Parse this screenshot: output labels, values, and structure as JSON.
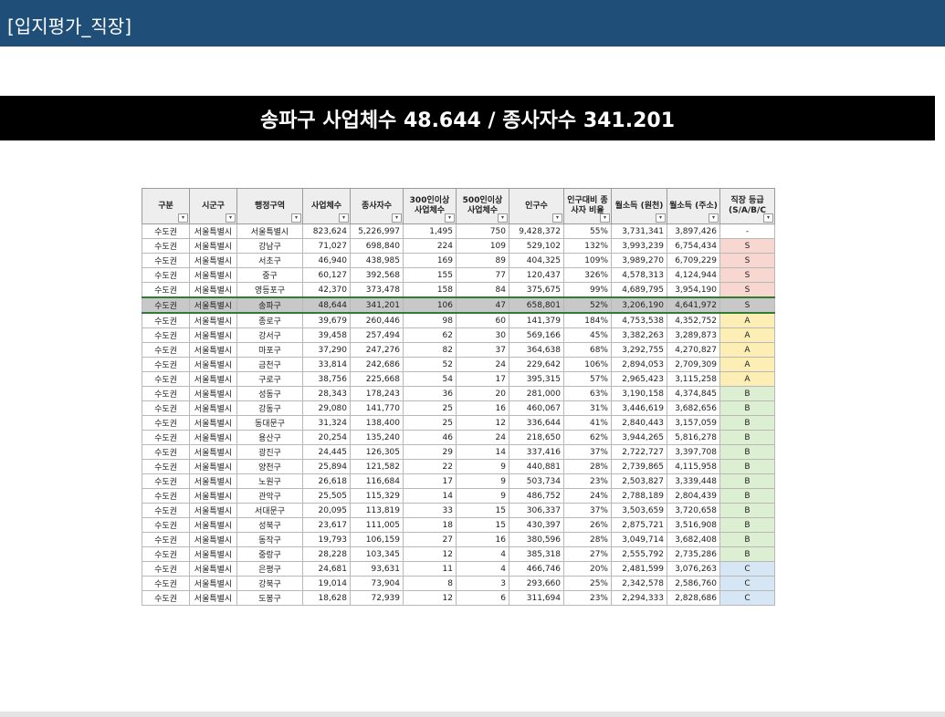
{
  "header": {
    "title": "[입지평가_직장]"
  },
  "banner": {
    "text": "송파구 사업체수 48.644 / 종사자수 341.201"
  },
  "table": {
    "columns": [
      "구분",
      "시군구",
      "행정구역",
      "사업체수",
      "종사자수",
      "300인이상 사업체수",
      "500인이상 사업체수",
      "인구수",
      "인구대비 종사자 비율",
      "월소득 (원천)",
      "월소득 (주소)",
      "직장 등급 (S/A/B/C"
    ],
    "highlight_row": 5,
    "rows": [
      [
        "수도권",
        "서울특별시",
        "서울특별시",
        "823,624",
        "5,226,997",
        "1,495",
        "750",
        "9,428,372",
        "55%",
        "3,731,341",
        "3,897,426",
        "-"
      ],
      [
        "수도권",
        "서울특별시",
        "강남구",
        "71,027",
        "698,840",
        "224",
        "109",
        "529,102",
        "132%",
        "3,993,239",
        "6,754,434",
        "S"
      ],
      [
        "수도권",
        "서울특별시",
        "서초구",
        "46,940",
        "438,985",
        "169",
        "89",
        "404,325",
        "109%",
        "3,989,270",
        "6,709,229",
        "S"
      ],
      [
        "수도권",
        "서울특별시",
        "중구",
        "60,127",
        "392,568",
        "155",
        "77",
        "120,437",
        "326%",
        "4,578,313",
        "4,124,944",
        "S"
      ],
      [
        "수도권",
        "서울특별시",
        "영등포구",
        "42,370",
        "373,478",
        "158",
        "84",
        "375,675",
        "99%",
        "4,689,795",
        "3,954,190",
        "S"
      ],
      [
        "수도권",
        "서울특별시",
        "송파구",
        "48,644",
        "341,201",
        "106",
        "47",
        "658,801",
        "52%",
        "3,206,190",
        "4,641,972",
        "S"
      ],
      [
        "수도권",
        "서울특별시",
        "종로구",
        "39,679",
        "260,446",
        "98",
        "60",
        "141,379",
        "184%",
        "4,753,538",
        "4,352,752",
        "A"
      ],
      [
        "수도권",
        "서울특별시",
        "강서구",
        "39,458",
        "257,494",
        "62",
        "30",
        "569,166",
        "45%",
        "3,382,263",
        "3,289,873",
        "A"
      ],
      [
        "수도권",
        "서울특별시",
        "마포구",
        "37,290",
        "247,276",
        "82",
        "37",
        "364,638",
        "68%",
        "3,292,755",
        "4,270,827",
        "A"
      ],
      [
        "수도권",
        "서울특별시",
        "금천구",
        "33,814",
        "242,686",
        "52",
        "24",
        "229,642",
        "106%",
        "2,894,053",
        "2,709,309",
        "A"
      ],
      [
        "수도권",
        "서울특별시",
        "구로구",
        "38,756",
        "225,668",
        "54",
        "17",
        "395,315",
        "57%",
        "2,965,423",
        "3,115,258",
        "A"
      ],
      [
        "수도권",
        "서울특별시",
        "성동구",
        "28,343",
        "178,243",
        "36",
        "20",
        "281,000",
        "63%",
        "3,190,158",
        "4,374,845",
        "B"
      ],
      [
        "수도권",
        "서울특별시",
        "강동구",
        "29,080",
        "141,770",
        "25",
        "16",
        "460,067",
        "31%",
        "3,446,619",
        "3,682,656",
        "B"
      ],
      [
        "수도권",
        "서울특별시",
        "동대문구",
        "31,324",
        "138,400",
        "25",
        "12",
        "336,644",
        "41%",
        "2,840,443",
        "3,157,059",
        "B"
      ],
      [
        "수도권",
        "서울특별시",
        "용산구",
        "20,254",
        "135,240",
        "46",
        "24",
        "218,650",
        "62%",
        "3,944,265",
        "5,816,278",
        "B"
      ],
      [
        "수도권",
        "서울특별시",
        "광진구",
        "24,445",
        "126,305",
        "29",
        "14",
        "337,416",
        "37%",
        "2,722,727",
        "3,397,708",
        "B"
      ],
      [
        "수도권",
        "서울특별시",
        "양천구",
        "25,894",
        "121,582",
        "22",
        "9",
        "440,881",
        "28%",
        "2,739,865",
        "4,115,958",
        "B"
      ],
      [
        "수도권",
        "서울특별시",
        "노원구",
        "26,618",
        "116,684",
        "17",
        "9",
        "503,734",
        "23%",
        "2,503,827",
        "3,339,448",
        "B"
      ],
      [
        "수도권",
        "서울특별시",
        "관악구",
        "25,505",
        "115,329",
        "14",
        "9",
        "486,752",
        "24%",
        "2,788,189",
        "2,804,439",
        "B"
      ],
      [
        "수도권",
        "서울특별시",
        "서대문구",
        "20,095",
        "113,819",
        "33",
        "15",
        "306,337",
        "37%",
        "3,503,659",
        "3,720,658",
        "B"
      ],
      [
        "수도권",
        "서울특별시",
        "성북구",
        "23,617",
        "111,005",
        "18",
        "15",
        "430,397",
        "26%",
        "2,875,721",
        "3,516,908",
        "B"
      ],
      [
        "수도권",
        "서울특별시",
        "동작구",
        "19,793",
        "106,159",
        "27",
        "16",
        "380,596",
        "28%",
        "3,049,714",
        "3,682,408",
        "B"
      ],
      [
        "수도권",
        "서울특별시",
        "중랑구",
        "28,228",
        "103,345",
        "12",
        "4",
        "385,318",
        "27%",
        "2,555,792",
        "2,735,286",
        "B"
      ],
      [
        "수도권",
        "서울특별시",
        "은평구",
        "24,681",
        "93,631",
        "11",
        "4",
        "466,746",
        "20%",
        "2,481,599",
        "3,076,263",
        "C"
      ],
      [
        "수도권",
        "서울특별시",
        "강북구",
        "19,014",
        "73,904",
        "8",
        "3",
        "293,660",
        "25%",
        "2,342,578",
        "2,586,760",
        "C"
      ],
      [
        "수도권",
        "서울특별시",
        "도봉구",
        "18,628",
        "72,939",
        "12",
        "6",
        "311,694",
        "23%",
        "2,294,333",
        "2,828,686",
        "C"
      ]
    ]
  }
}
